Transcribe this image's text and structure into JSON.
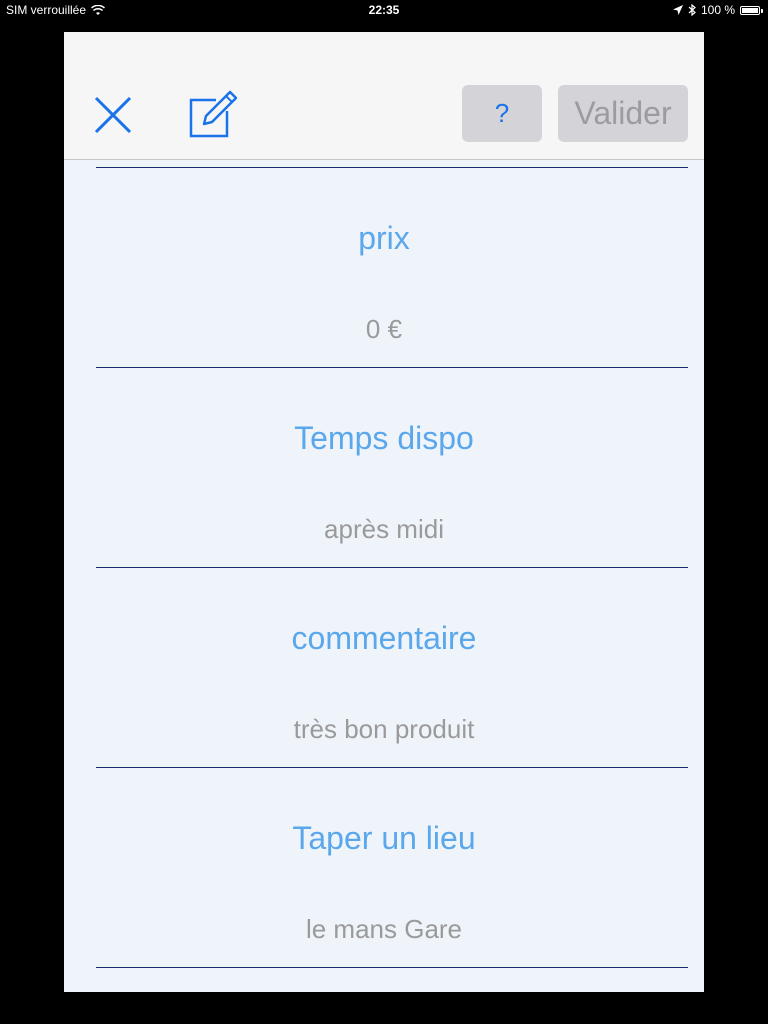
{
  "status_bar": {
    "carrier": "SIM verrouillée",
    "time": "22:35",
    "battery": "100 %"
  },
  "toolbar": {
    "help_label": "?",
    "validate_label": "Valider"
  },
  "fields": [
    {
      "label": "prix",
      "value": "0 €"
    },
    {
      "label": "Temps dispo",
      "value": "après midi"
    },
    {
      "label": "commentaire",
      "value": "très bon produit"
    },
    {
      "label": "Taper un lieu",
      "value": "le mans Gare"
    }
  ]
}
